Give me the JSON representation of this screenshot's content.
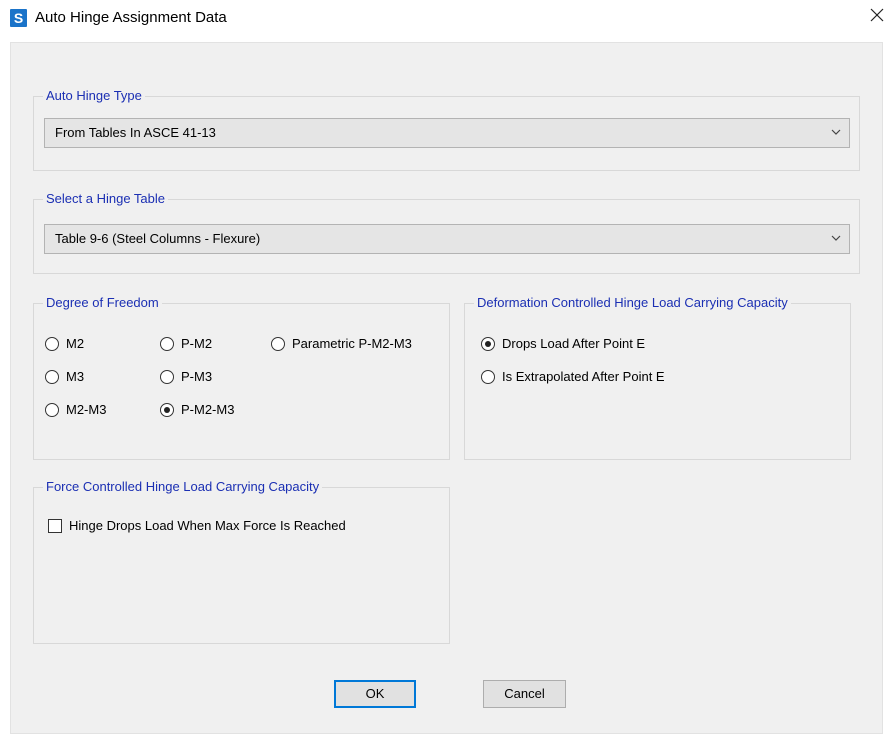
{
  "window": {
    "title": "Auto Hinge Assignment Data",
    "app_icon_letter": "S",
    "icons": {
      "app": "sap-app-icon",
      "close": "close-icon",
      "dropdown": "chevron-down-icon"
    },
    "colors": {
      "legend_text": "#1b2fb3",
      "app_icon": "#1a73c9",
      "default_button_border": "#0078d7"
    }
  },
  "auto_hinge_type": {
    "legend": "Auto Hinge Type",
    "selected": "From Tables In ASCE 41-13"
  },
  "hinge_table": {
    "legend": "Select a Hinge Table",
    "selected": "Table 9-6 (Steel Columns - Flexure)"
  },
  "dof": {
    "legend": "Degree of Freedom",
    "options": [
      {
        "label": "M2",
        "checked": false
      },
      {
        "label": "M3",
        "checked": false
      },
      {
        "label": "M2-M3",
        "checked": false
      },
      {
        "label": "P-M2",
        "checked": false
      },
      {
        "label": "P-M3",
        "checked": false
      },
      {
        "label": "P-M2-M3",
        "checked": true
      },
      {
        "label": "Parametric P-M2-M3",
        "checked": false
      }
    ]
  },
  "deformation": {
    "legend": "Deformation Controlled Hinge Load Carrying Capacity",
    "options": [
      {
        "label": "Drops Load After Point E",
        "checked": true
      },
      {
        "label": "Is Extrapolated After Point E",
        "checked": false
      }
    ]
  },
  "force": {
    "legend": "Force Controlled Hinge Load Carrying Capacity",
    "checkbox_label": "Hinge Drops Load When Max Force Is Reached",
    "checked": false
  },
  "buttons": {
    "ok": "OK",
    "cancel": "Cancel"
  }
}
